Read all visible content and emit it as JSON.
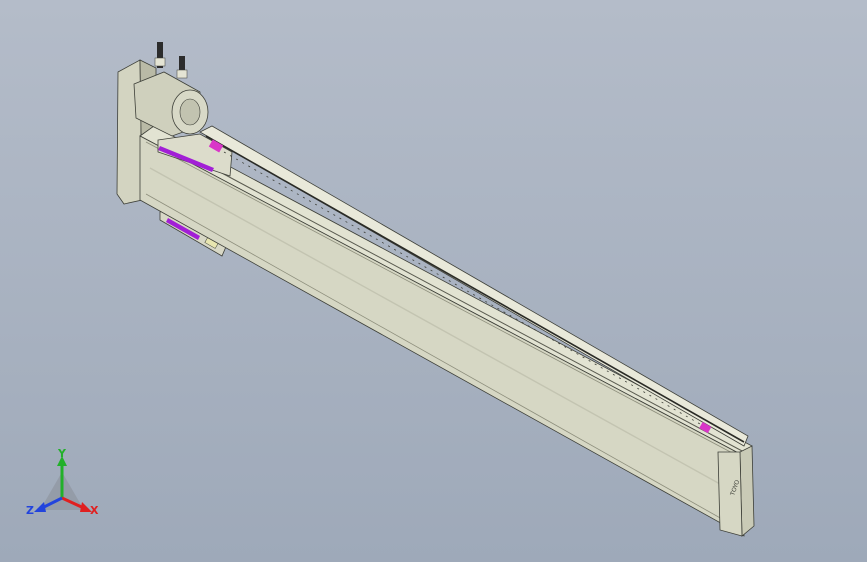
{
  "viewport": {
    "background_top": "#b4bcc9",
    "background_bottom": "#9ea9b9"
  },
  "model": {
    "body_color": "#d6d7c4",
    "body_shade": "#a8a995",
    "edge_color": "#3d3f38",
    "accent_purple": "#a21fd6",
    "accent_magenta": "#d936c8",
    "motor_color": "#cfd0bd",
    "connector_color": "#2c2c2c",
    "end_label": "TOYO"
  },
  "triad": {
    "x_label": "X",
    "y_label": "Y",
    "z_label": "Z",
    "x_color": "#e02020",
    "y_color": "#22b02a",
    "z_color": "#2244dd"
  }
}
